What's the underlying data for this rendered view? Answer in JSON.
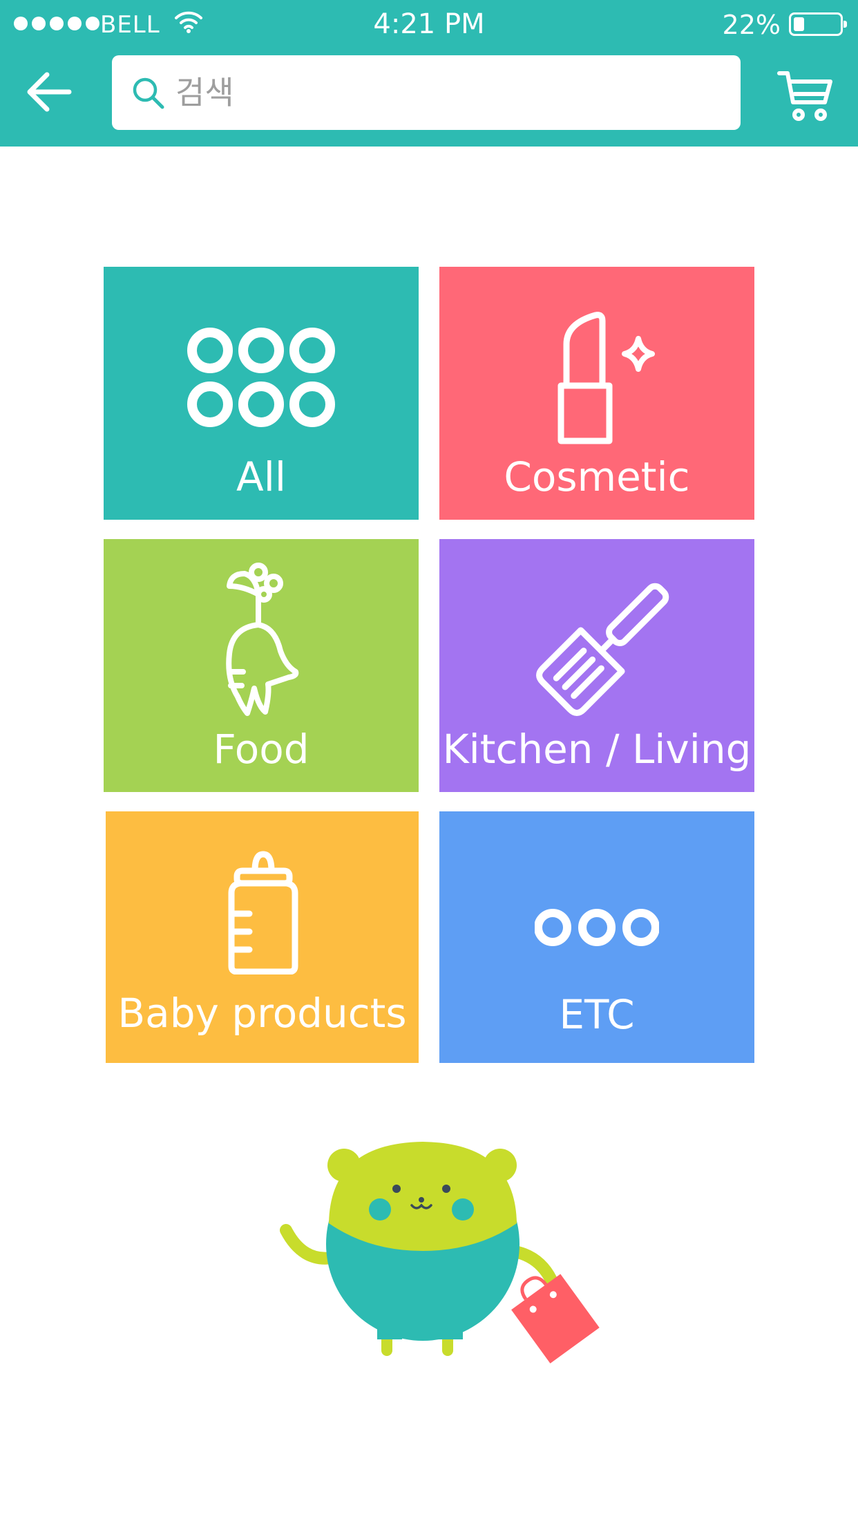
{
  "status_bar": {
    "carrier": "BELL",
    "time": "4:21 PM",
    "battery_percent": "22%",
    "battery_level": 0.22
  },
  "search": {
    "placeholder": "검색",
    "value": ""
  },
  "icons": {
    "back": "arrow-left-icon",
    "search": "magnifier-icon",
    "cart": "shopping-cart-icon"
  },
  "categories": [
    {
      "label": "All",
      "color": "#2dbbb2",
      "icon": "six-circles-icon"
    },
    {
      "label": "Cosmetic",
      "color": "#ff6877",
      "icon": "lipstick-icon"
    },
    {
      "label": "Food",
      "color": "#a4d253",
      "icon": "radish-icon"
    },
    {
      "label": "Kitchen /  Living",
      "color": "#a374f1",
      "icon": "spatula-icon"
    },
    {
      "label": "Baby products",
      "color": "#fdbd41",
      "icon": "baby-bottle-icon"
    },
    {
      "label": "ETC",
      "color": "#5e9ef4",
      "icon": "three-circles-icon"
    }
  ],
  "colors": {
    "header": "#2dbbb2",
    "mascot_head": "#c8dc2c",
    "mascot_body": "#2dbbb2",
    "bag": "#ff5f66"
  }
}
